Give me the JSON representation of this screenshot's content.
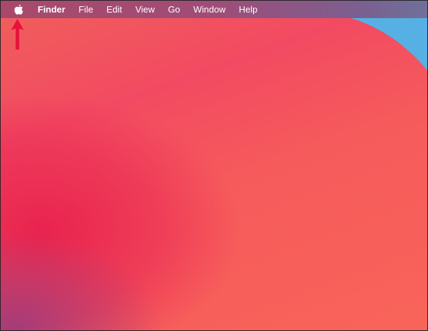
{
  "menubar": {
    "apple_icon": "apple-logo-icon",
    "items": [
      "Finder",
      "File",
      "Edit",
      "View",
      "Go",
      "Window",
      "Help"
    ]
  },
  "annotation": {
    "icon": "arrow-up-icon",
    "color": "#e8103c"
  },
  "colors": {
    "wallpaper_red": "#f24a62",
    "wallpaper_blue": "#56b0e4"
  }
}
